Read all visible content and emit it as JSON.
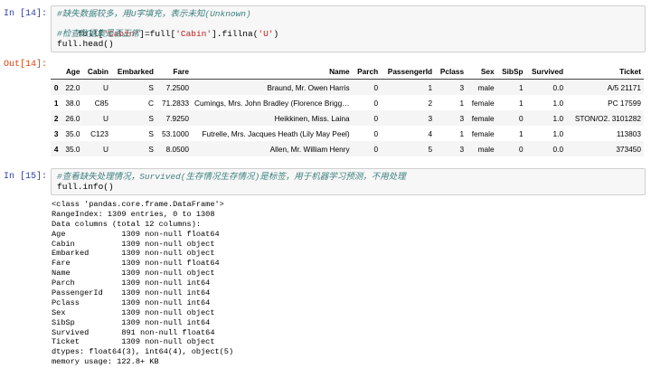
{
  "cells": [
    {
      "in_prompt": "In  [14]:",
      "lines": [
        {
          "type": "comment",
          "text": "#缺失数据较多，用U字填充，表示未知(Unknown)"
        },
        {
          "type": "code",
          "parts": [
            "full[",
            "'Cabin'",
            "]=full[",
            "'Cabin'",
            "].fillna(",
            "'U'",
            ")"
          ]
        },
        {
          "type": "comment",
          "text": "#检查数据集是否正常"
        },
        {
          "type": "code",
          "parts": [
            "full.head()"
          ]
        }
      ],
      "out_prompt": "Out[14]:",
      "table": {
        "columns": [
          "",
          "Age",
          "Cabin",
          "Embarked",
          "Fare",
          "Name",
          "Parch",
          "PassengerId",
          "Pclass",
          "Sex",
          "SibSp",
          "Survived",
          "Ticket"
        ],
        "rows": [
          [
            "0",
            "22.0",
            "U",
            "S",
            "7.2500",
            "Braund, Mr. Owen Harris",
            "0",
            "1",
            "3",
            "male",
            "1",
            "0.0",
            "A/5 21171"
          ],
          [
            "1",
            "38.0",
            "C85",
            "C",
            "71.2833",
            "Cumings, Mrs. John Bradley (Florence Briggs Th...",
            "0",
            "2",
            "1",
            "female",
            "1",
            "1.0",
            "PC 17599"
          ],
          [
            "2",
            "26.0",
            "U",
            "S",
            "7.9250",
            "Heikkinen, Miss. Laina",
            "0",
            "3",
            "3",
            "female",
            "0",
            "1.0",
            "STON/O2. 3101282"
          ],
          [
            "3",
            "35.0",
            "C123",
            "S",
            "53.1000",
            "Futrelle, Mrs. Jacques Heath (Lily May Peel)",
            "0",
            "4",
            "1",
            "female",
            "1",
            "1.0",
            "113803"
          ],
          [
            "4",
            "35.0",
            "U",
            "S",
            "8.0500",
            "Allen, Mr. William Henry",
            "0",
            "5",
            "3",
            "male",
            "0",
            "0.0",
            "373450"
          ]
        ]
      }
    },
    {
      "in_prompt": "In  [15]:",
      "lines": [
        {
          "type": "comment",
          "text": "#查看缺失处理情况，Survived(生存情况生存情况)是标签，用于机器学习预测，不用处理"
        },
        {
          "type": "code",
          "parts": [
            "full.info()"
          ]
        }
      ],
      "stdout": [
        "<class 'pandas.core.frame.DataFrame'>",
        "RangeIndex: 1309 entries, 0 to 1308",
        "Data columns (total 12 columns):",
        "Age            1309 non-null float64",
        "Cabin          1309 non-null object",
        "Embarked       1309 non-null object",
        "Fare           1309 non-null float64",
        "Name           1309 non-null object",
        "Parch          1309 non-null int64",
        "PassengerId    1309 non-null int64",
        "Pclass         1309 non-null int64",
        "Sex            1309 non-null object",
        "SibSp          1309 non-null int64",
        "Survived       891 non-null float64",
        "Ticket         1309 non-null object",
        "dtypes: float64(3), int64(4), object(5)",
        "memory usage: 122.8+ KB"
      ]
    }
  ]
}
